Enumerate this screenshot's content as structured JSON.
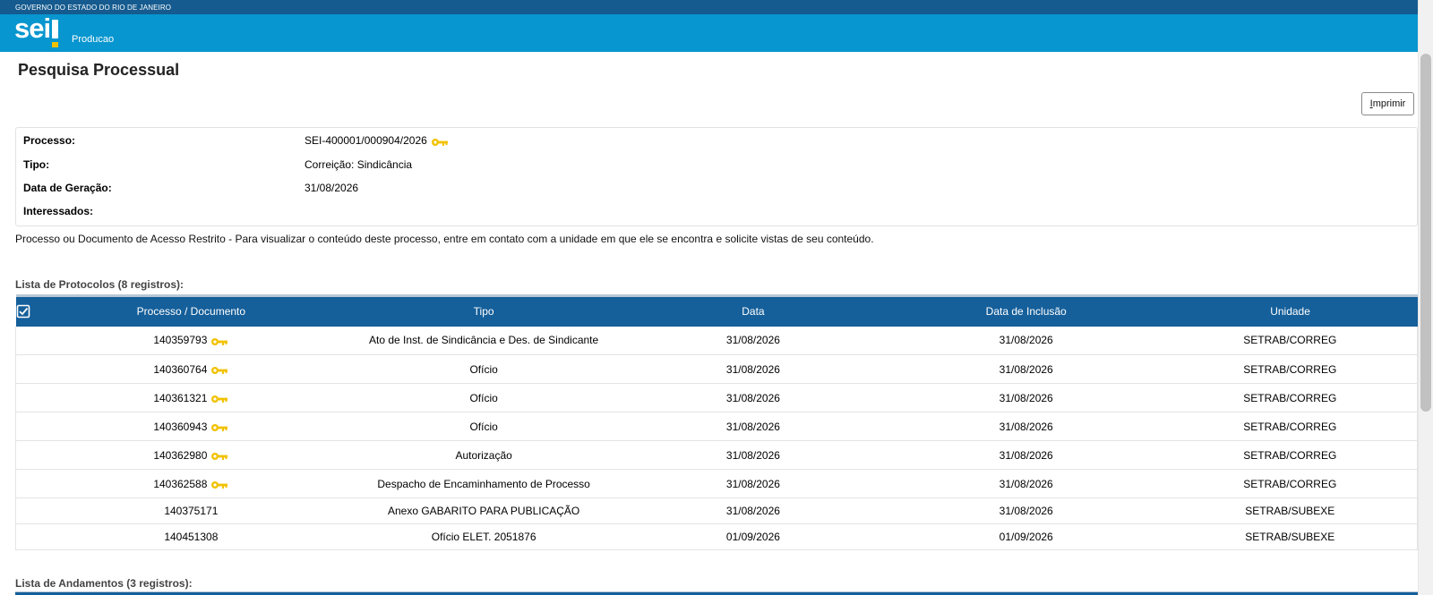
{
  "header": {
    "gov_name": "GOVERNO DO ESTADO DO RIO DE JANEIRO",
    "logo_text": "sei",
    "environment": "Producao"
  },
  "page": {
    "title": "Pesquisa Processual",
    "print_button": {
      "accesskey_letter": "I",
      "rest": "mprimir"
    }
  },
  "info": {
    "processo_label": "Processo:",
    "processo_value": "SEI-400001/000904/2026",
    "tipo_label": "Tipo:",
    "tipo_value": "Correição: Sindicância",
    "data_label": "Data de Geração:",
    "data_value": "31/08/2026",
    "interessados_label": "Interessados:"
  },
  "notice": "Processo ou Documento de Acesso Restrito - Para visualizar o conteúdo deste processo, entre em contato com a unidade em que ele se encontra e solicite vistas de seu conteúdo.",
  "protocolos": {
    "caption": "Lista de Protocolos (8 registros):",
    "columns": [
      "Processo / Documento",
      "Tipo",
      "Data",
      "Data de Inclusão",
      "Unidade"
    ],
    "rows": [
      {
        "doc": "140359793",
        "restricted": true,
        "tipo": "Ato de Inst. de Sindicância e Des. de Sindicante",
        "data": "31/08/2026",
        "inclusao": "31/08/2026",
        "unidade": "SETRAB/CORREG"
      },
      {
        "doc": "140360764",
        "restricted": true,
        "tipo": "Ofício",
        "data": "31/08/2026",
        "inclusao": "31/08/2026",
        "unidade": "SETRAB/CORREG"
      },
      {
        "doc": "140361321",
        "restricted": true,
        "tipo": "Ofício",
        "data": "31/08/2026",
        "inclusao": "31/08/2026",
        "unidade": "SETRAB/CORREG"
      },
      {
        "doc": "140360943",
        "restricted": true,
        "tipo": "Ofício",
        "data": "31/08/2026",
        "inclusao": "31/08/2026",
        "unidade": "SETRAB/CORREG"
      },
      {
        "doc": "140362980",
        "restricted": true,
        "tipo": "Autorização",
        "data": "31/08/2026",
        "inclusao": "31/08/2026",
        "unidade": "SETRAB/CORREG"
      },
      {
        "doc": "140362588",
        "restricted": true,
        "tipo": "Despacho de Encaminhamento de Processo",
        "data": "31/08/2026",
        "inclusao": "31/08/2026",
        "unidade": "SETRAB/CORREG"
      },
      {
        "doc": "140375171",
        "restricted": false,
        "tipo": "Anexo GABARITO PARA PUBLICAÇÃO",
        "data": "31/08/2026",
        "inclusao": "31/08/2026",
        "unidade": "SETRAB/SUBEXE"
      },
      {
        "doc": "140451308",
        "restricted": false,
        "tipo": "Ofício ELET. 2051876",
        "data": "01/09/2026",
        "inclusao": "01/09/2026",
        "unidade": "SETRAB/SUBEXE"
      }
    ]
  },
  "andamentos": {
    "caption": "Lista de Andamentos (3 registros):"
  },
  "colors": {
    "gov_bar": "#155b8f",
    "brand_bar": "#0796cf",
    "table_header": "#155f9a",
    "key_icon": "#f2c200"
  },
  "icons": {
    "restricted": "key-icon",
    "select_all": "checkbox-checked-icon"
  }
}
